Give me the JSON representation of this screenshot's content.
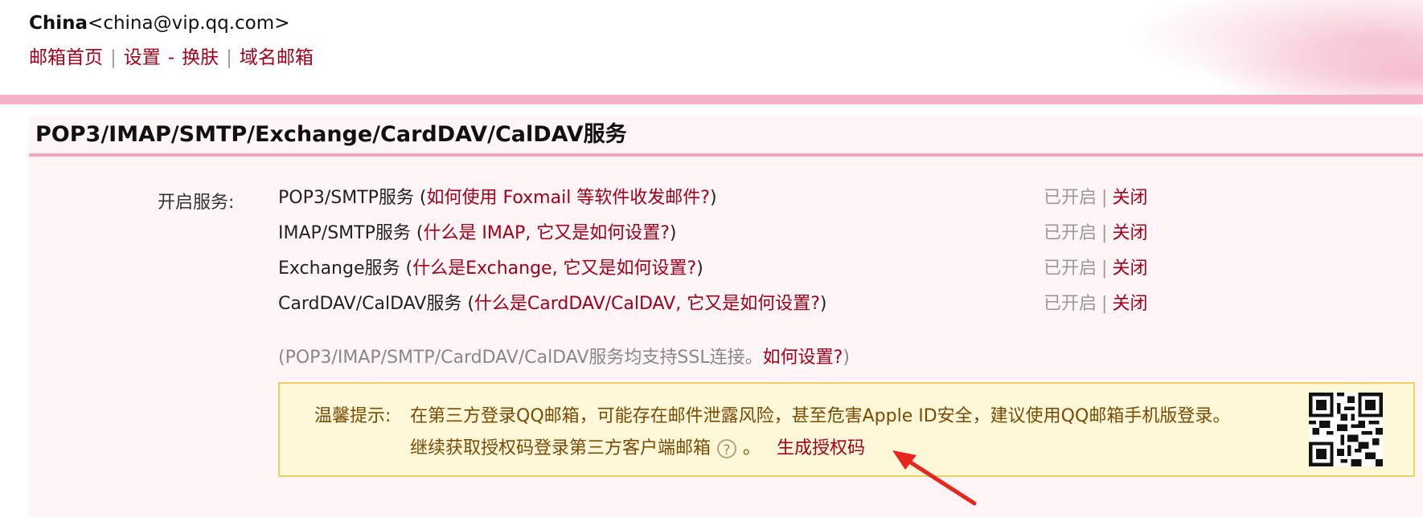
{
  "header": {
    "name": "China",
    "email": "<china@vip.qq.com>"
  },
  "nav": {
    "home": "邮箱首页",
    "settings": "设置",
    "dash": "-",
    "skin": "换肤",
    "domain_mail": "域名邮箱",
    "separator": "|"
  },
  "panel": {
    "title": "POP3/IMAP/SMTP/Exchange/CardDAV/CalDAV服务",
    "label": "开启服务:",
    "services": [
      {
        "name": "POP3/SMTP服务 (",
        "link": "如何使用 Foxmail 等软件收发邮件?",
        "tail": ")",
        "status": "已开启",
        "sep": "|",
        "action": "关闭"
      },
      {
        "name": "IMAP/SMTP服务 (",
        "link": "什么是 IMAP, 它又是如何设置?",
        "tail": ")",
        "status": "已开启",
        "sep": "|",
        "action": "关闭"
      },
      {
        "name": "Exchange服务 (",
        "link": "什么是Exchange, 它又是如何设置?",
        "tail": ")",
        "status": "已开启",
        "sep": "|",
        "action": "关闭"
      },
      {
        "name": "CardDAV/CalDAV服务 (",
        "link": "什么是CardDAV/CalDAV, 它又是如何设置?",
        "tail": ")",
        "status": "已开启",
        "sep": "|",
        "action": "关闭"
      }
    ],
    "ssl_note": "(POP3/IMAP/SMTP/CardDAV/CalDAV服务均支持SSL连接。",
    "ssl_link": "如何设置?",
    "ssl_tail": ")"
  },
  "tip": {
    "label": "温馨提示:",
    "line1": "在第三方登录QQ邮箱，可能存在邮件泄露风险，甚至危害Apple ID安全，建议使用QQ邮箱手机版登录。",
    "line2": "继续获取授权码登录第三方客户端邮箱",
    "help_glyph": "?",
    "period": "。",
    "generate": "生成授权码"
  },
  "colors": {
    "link": "#a3001b",
    "band": "#f6b2c8",
    "tip_bg": "#fff8d8",
    "tip_border": "#f1cf67",
    "arrow": "#e8261b"
  }
}
